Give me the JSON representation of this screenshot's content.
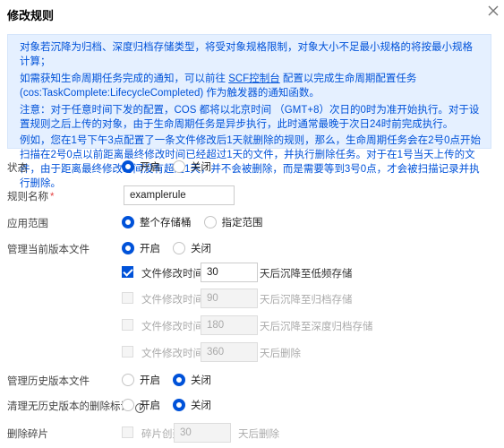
{
  "dialog": {
    "title": "修改规则",
    "close_icon": "close-icon"
  },
  "notice": {
    "line1": "对象若沉降为归档、深度归档存储类型，将受对象规格限制，对象大小不足最小规格的将按最小规格计算；",
    "line2_prefix": "如需获知生命周期任务完成的通知，可以前往 ",
    "line2_link": "SCF控制台",
    "line2_suffix": " 配置以完成生命周期配置任务(cos:TaskComplete:LifecycleCompleted) 作为触发器的通知函数。",
    "line3": "注意：对于任意时间下发的配置，COS 都将以北京时间 （GMT+8）次日的0时为准开始执行。对于设置规则之后上传的对象，由于生命周期任务是异步执行，此时通常最晚于次日24时前完成执行。",
    "line4": "例如，您在1号下午3点配置了一条文件修改后1天就删除的规则，那么，生命周期任务会在2号0点开始扫描在2号0点以前距离最终修改时间已经超过1天的文件，并执行删除任务。对于在1号当天上传的文件，由于距离最终修改时间没有超过1天，并不会被删除，而是需要等到3号0点，才会被扫描记录并执行删除。"
  },
  "form": {
    "status": {
      "label": "状态",
      "options": [
        "开启",
        "关闭"
      ],
      "selected": "开启"
    },
    "rule_name": {
      "label": "规则名称",
      "required_mark": "*",
      "value": "examplerule"
    },
    "scope": {
      "label": "应用范围",
      "options": [
        "整个存储桶",
        "指定范围"
      ],
      "selected": "整个存储桶"
    },
    "current_version": {
      "label": "管理当前版本文件",
      "options": [
        "开启",
        "关闭"
      ],
      "selected": "开启",
      "transitions": [
        {
          "prefix": "文件修改时间的",
          "days": "30",
          "suffix": "天后沉降至低频存储",
          "checked": true,
          "disabled": false
        },
        {
          "prefix": "文件修改时间的",
          "days": "90",
          "suffix": "天后沉降至归档存储",
          "checked": false,
          "disabled": true
        },
        {
          "prefix": "文件修改时间的",
          "days": "180",
          "suffix": "天后沉降至深度归档存储",
          "checked": false,
          "disabled": true
        },
        {
          "prefix": "文件修改时间的",
          "days": "360",
          "suffix": "天后删除",
          "checked": false,
          "disabled": true
        }
      ]
    },
    "history_version": {
      "label": "管理历史版本文件",
      "options": [
        "开启",
        "关闭"
      ],
      "selected": "关闭"
    },
    "clean_delete_marker": {
      "label": "清理无历史版本的删除标记",
      "options": [
        "开启",
        "关闭"
      ],
      "selected": "关闭"
    },
    "delete_fragments": {
      "label": "删除碎片",
      "prefix": "碎片创建",
      "days": "30",
      "suffix": "天后删除",
      "checked": false
    }
  },
  "colors": {
    "accent": "#0052d9",
    "notice_bg": "#e5f0ff",
    "required": "#e54545"
  }
}
